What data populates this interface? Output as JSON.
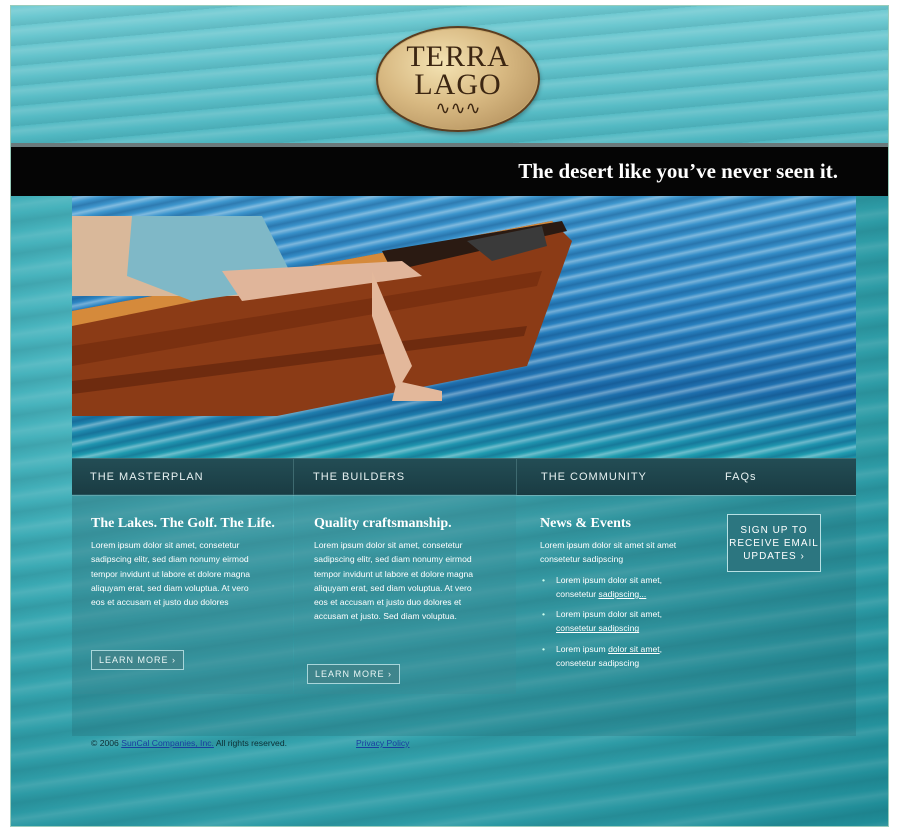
{
  "brand": {
    "logo_line1": "TERRA",
    "logo_line2": "LAGO",
    "tagline": "The desert like you’ve never seen it."
  },
  "nav": {
    "items": [
      "THE MASTERPLAN",
      "THE BUILDERS",
      "THE COMMUNITY",
      "FAQs"
    ]
  },
  "columns": [
    {
      "heading": "The Lakes. The Golf. The Life.",
      "body": "Lorem ipsum dolor sit amet, consetetur sadipscing elitr, sed diam nonumy eirmod tempor invidunt ut labore et dolore magna aliquyam erat, sed diam voluptua. At vero eos et accusam et justo duo dolores",
      "button": "LEARN MORE ›"
    },
    {
      "heading": "Quality craftsmanship.",
      "body": "Lorem ipsum dolor sit amet, consetetur sadipscing elitr, sed diam nonumy eirmod tempor invidunt ut labore et dolore magna aliquyam erat, sed diam voluptua. At vero eos et accusam et justo duo dolores et accusam et justo. Sed diam voluptua.",
      "button": "LEARN MORE ›"
    }
  ],
  "news": {
    "heading": "News & Events",
    "intro": "Lorem ipsum dolor sit amet sit amet consetetur sadipscing",
    "items": [
      {
        "pre": "Lorem ipsum dolor sit amet, consetetur ",
        "link": "sadipscing...",
        "post": ""
      },
      {
        "pre": "Lorem ipsum dolor sit amet, ",
        "link": "consetetur sadipscing",
        "post": ""
      },
      {
        "pre": "Lorem ipsum ",
        "link": "dolor sit amet",
        "post": ", consetetur sadipscing"
      }
    ]
  },
  "signup": {
    "line1": "SIGN UP TO",
    "line2": "RECEIVE EMAIL",
    "line3": "UPDATES ›"
  },
  "footer": {
    "copyright_pre": "© 2006 ",
    "company_link": "SunCal Companies, Inc.",
    "copyright_post": " All rights reserved.",
    "privacy": "Privacy Policy"
  },
  "colors": {
    "water": "#4fb7c1",
    "band": "#050505",
    "nav": "#1a3c43",
    "button": "#3f858c"
  }
}
